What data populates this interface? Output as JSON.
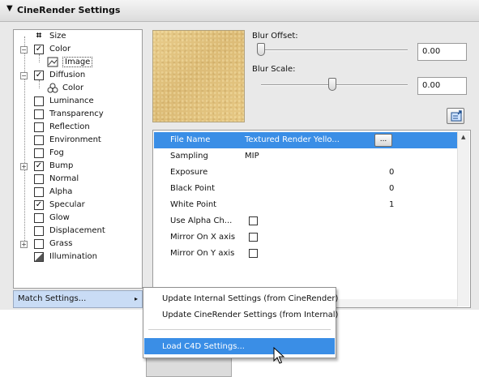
{
  "header": {
    "title": "CineRender Settings"
  },
  "tree": {
    "items": [
      {
        "label": "Size",
        "checked": false,
        "expander": "",
        "icon": "size-icon"
      },
      {
        "label": "Color",
        "checked": true,
        "expander": "−"
      },
      {
        "label": "Image",
        "sub": true,
        "selected": true,
        "icon": "image-icon"
      },
      {
        "label": "Diffusion",
        "checked": true,
        "expander": "−"
      },
      {
        "label": "Color",
        "sub": true,
        "icon": "color-circles-icon"
      },
      {
        "label": "Luminance",
        "checked": false
      },
      {
        "label": "Transparency",
        "checked": false
      },
      {
        "label": "Reflection",
        "checked": false
      },
      {
        "label": "Environment",
        "checked": false
      },
      {
        "label": "Fog",
        "checked": false
      },
      {
        "label": "Bump",
        "checked": true,
        "expander": "+"
      },
      {
        "label": "Normal",
        "checked": false
      },
      {
        "label": "Alpha",
        "checked": false
      },
      {
        "label": "Specular",
        "checked": true
      },
      {
        "label": "Glow",
        "checked": false
      },
      {
        "label": "Displacement",
        "checked": false
      },
      {
        "label": "Grass",
        "checked": false,
        "expander": "+"
      },
      {
        "label": "Illumination",
        "icon": "illumination-icon"
      }
    ],
    "check_mark": "✓"
  },
  "match_button": {
    "label": "Match Settings...",
    "arrow": "▸"
  },
  "sliders": {
    "blur_offset": {
      "label": "Blur Offset:",
      "value": "0.00",
      "level": 0.0
    },
    "blur_scale": {
      "label": "Blur Scale:",
      "value": "0.00",
      "level": 0.5
    }
  },
  "props": {
    "rows": [
      {
        "name": "File Name",
        "value": "Textured Render Yello...",
        "selected": true,
        "button": "..."
      },
      {
        "name": "Sampling",
        "value": "MIP"
      },
      {
        "name": "Exposure",
        "value": "0"
      },
      {
        "name": "Black Point",
        "value": "0"
      },
      {
        "name": "White Point",
        "value": "1"
      },
      {
        "name": "Use Alpha Ch...",
        "checkbox": true
      },
      {
        "name": "Mirror On X axis",
        "checkbox": true
      },
      {
        "name": "Mirror On Y axis",
        "checkbox": true
      }
    ]
  },
  "menu": {
    "items": [
      "Update Internal Settings (from CineRender)",
      "Update CineRender Settings (from Internal)",
      "Load C4D Settings..."
    ]
  },
  "colors": {
    "selection": "#3a8ee6",
    "match_button": "#c9dcf5"
  }
}
